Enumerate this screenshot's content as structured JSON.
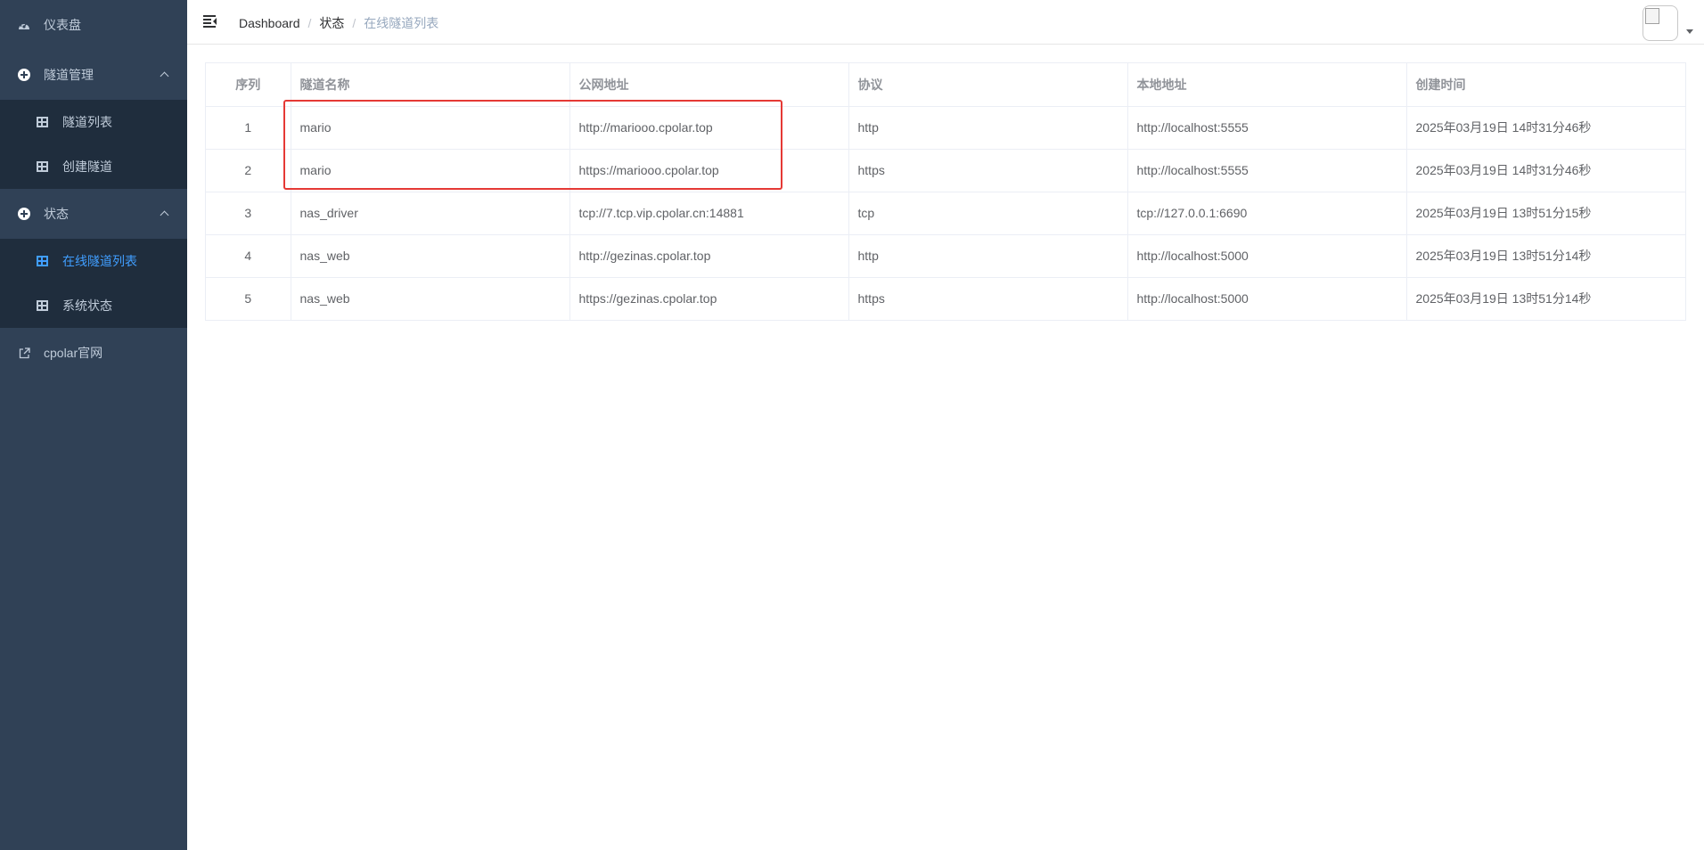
{
  "sidebar": {
    "items": [
      {
        "label": "仪表盘",
        "icon": "dashboard-icon"
      },
      {
        "label": "隧道管理",
        "icon": "circle-plus-icon"
      },
      {
        "label": "隧道列表",
        "icon": "table-icon"
      },
      {
        "label": "创建隧道",
        "icon": "table-icon"
      },
      {
        "label": "状态",
        "icon": "circle-plus-icon"
      },
      {
        "label": "在线隧道列表",
        "icon": "table-icon"
      },
      {
        "label": "系统状态",
        "icon": "table-icon"
      },
      {
        "label": "cpolar官网",
        "icon": "external-link-icon"
      }
    ],
    "active_color": "#409eff",
    "background": "#304156"
  },
  "breadcrumb": {
    "items": [
      "Dashboard",
      "状态",
      "在线隧道列表"
    ],
    "separator": "/"
  },
  "table": {
    "columns": [
      "序列",
      "隧道名称",
      "公网地址",
      "协议",
      "本地地址",
      "创建时间"
    ],
    "rows": [
      [
        "1",
        "mario",
        "http://mariooo.cpolar.top",
        "http",
        "http://localhost:5555",
        "2025年03月19日 14时31分46秒"
      ],
      [
        "2",
        "mario",
        "https://mariooo.cpolar.top",
        "https",
        "http://localhost:5555",
        "2025年03月19日 14时31分46秒"
      ],
      [
        "3",
        "nas_driver",
        "tcp://7.tcp.vip.cpolar.cn:14881",
        "tcp",
        "tcp://127.0.0.1:6690",
        "2025年03月19日 13时51分15秒"
      ],
      [
        "4",
        "nas_web",
        "http://gezinas.cpolar.top",
        "http",
        "http://localhost:5000",
        "2025年03月19日 13时51分14秒"
      ],
      [
        "5",
        "nas_web",
        "https://gezinas.cpolar.top",
        "https",
        "http://localhost:5000",
        "2025年03月19日 13时51分14秒"
      ]
    ]
  },
  "annotation": {
    "color": "#e53935"
  }
}
